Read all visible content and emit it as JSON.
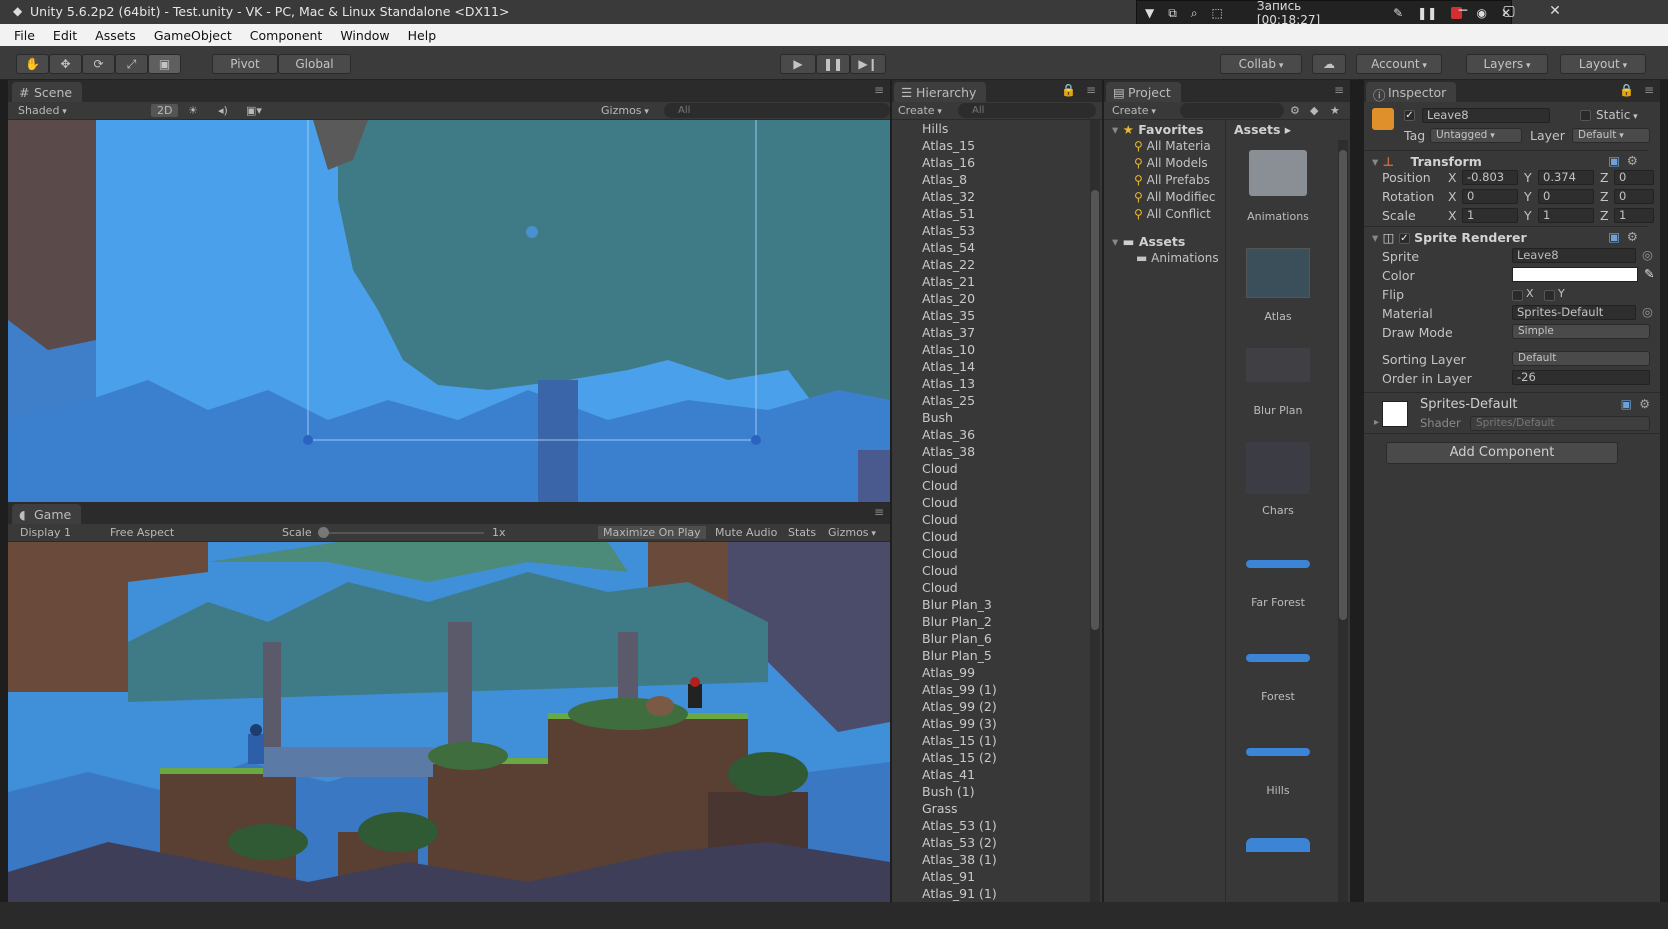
{
  "window": {
    "title": "Unity 5.6.2p2 (64bit) - Test.unity - VK - PC, Mac & Linux Standalone <DX11>",
    "controls": {
      "minimize": "─",
      "maximize": "▢",
      "close": "✕"
    }
  },
  "recorder": {
    "label": "Запись [00:18:27]"
  },
  "menu": [
    "File",
    "Edit",
    "Assets",
    "GameObject",
    "Component",
    "Window",
    "Help"
  ],
  "toolbar": {
    "pivot": "Pivot",
    "global": "Global",
    "collab": "Collab",
    "account": "Account",
    "layers": "Layers",
    "layout": "Layout"
  },
  "scene": {
    "tab": "Scene",
    "shading": "Shaded",
    "mode_2d": "2D",
    "gizmos": "Gizmos",
    "search_placeholder": "All"
  },
  "game": {
    "tab": "Game",
    "display": "Display 1",
    "aspect": "Free Aspect",
    "scale_label": "Scale",
    "scale_value": "1x",
    "maximize_on_play": "Maximize On Play",
    "mute_audio": "Mute Audio",
    "stats": "Stats",
    "gizmos": "Gizmos"
  },
  "hierarchy": {
    "tab": "Hierarchy",
    "create": "Create",
    "search_placeholder": "All",
    "items": [
      "Hills",
      "Atlas_15",
      "Atlas_16",
      "Atlas_8",
      "Atlas_32",
      "Atlas_51",
      "Atlas_53",
      "Atlas_54",
      "Atlas_22",
      "Atlas_21",
      "Atlas_20",
      "Atlas_35",
      "Atlas_37",
      "Atlas_10",
      "Atlas_14",
      "Atlas_13",
      "Atlas_25",
      "Bush",
      "Atlas_36",
      "Atlas_38",
      "Cloud",
      "Cloud",
      "Cloud",
      "Cloud",
      "Cloud",
      "Cloud",
      "Cloud",
      "Cloud",
      "Blur Plan_3",
      "Blur Plan_2",
      "Blur Plan_6",
      "Blur Plan_5",
      "Atlas_99",
      "Atlas_99 (1)",
      "Atlas_99 (2)",
      "Atlas_99 (3)",
      "Atlas_15 (1)",
      "Atlas_15 (2)",
      "Atlas_41",
      "Bush (1)",
      "Grass",
      "Atlas_53 (1)",
      "Atlas_53 (2)",
      "Atlas_38 (1)",
      "Atlas_91",
      "Atlas_91 (1)"
    ]
  },
  "project": {
    "tab": "Project",
    "create": "Create",
    "favorites_label": "Favorites",
    "favorites": [
      "All Materia",
      "All Models",
      "All Prefabs",
      "All Modifiec",
      "All Conflict"
    ],
    "assets_label": "Assets",
    "assets_children": [
      "Animations"
    ],
    "breadcrumb": "Assets",
    "tiles": [
      "Animations",
      "Atlas",
      "Blur Plan",
      "Chars",
      "Far Forest",
      "Forest",
      "Hills"
    ]
  },
  "inspector": {
    "tab": "Inspector",
    "object_name": "Leave8",
    "static": "Static",
    "tag_label": "Tag",
    "tag_value": "Untagged",
    "layer_label": "Layer",
    "layer_value": "Default",
    "transform": {
      "title": "Transform",
      "rows": [
        {
          "label": "Position",
          "x": "-0.803",
          "y": "0.374",
          "z": "0"
        },
        {
          "label": "Rotation",
          "x": "0",
          "y": "0",
          "z": "0"
        },
        {
          "label": "Scale",
          "x": "1",
          "y": "1",
          "z": "1"
        }
      ],
      "axis": {
        "x": "X",
        "y": "Y",
        "z": "Z"
      }
    },
    "sprite_renderer": {
      "title": "Sprite Renderer",
      "sprite_label": "Sprite",
      "sprite_value": "Leave8",
      "color_label": "Color",
      "color_value": "#ffffff",
      "flip_label": "Flip",
      "flip_x": "X",
      "flip_y": "Y",
      "material_label": "Material",
      "material_value": "Sprites-Default",
      "draw_mode_label": "Draw Mode",
      "draw_mode_value": "Simple",
      "sorting_layer_label": "Sorting Layer",
      "sorting_layer_value": "Default",
      "order_label": "Order in Layer",
      "order_value": "-26"
    },
    "material": {
      "name": "Sprites-Default",
      "shader_label": "Shader",
      "shader_value": "Sprites/Default"
    },
    "add_component": "Add Component"
  },
  "colors": {
    "sky": "#3f8fd9",
    "tree_canopy": "#3f7b86",
    "ground": "#5a3f33",
    "grass": "#6aa843",
    "accent_blue": "#3c7fd1"
  }
}
